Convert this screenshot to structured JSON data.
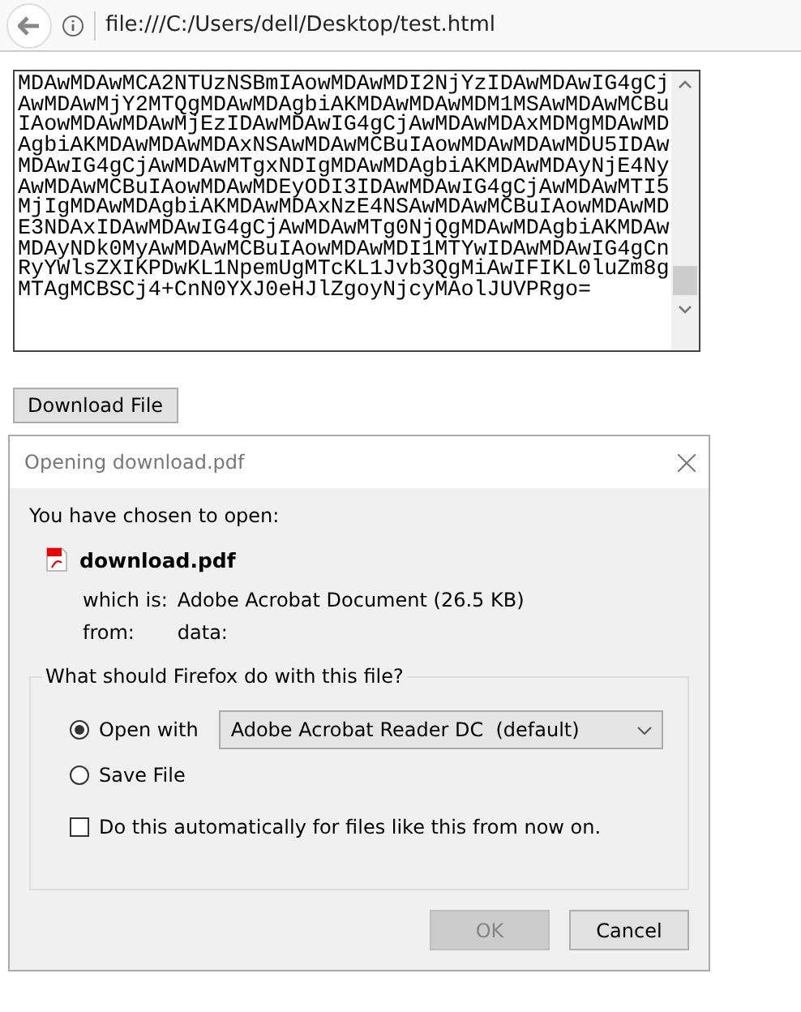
{
  "toolbar": {
    "url": "file:///C:/Users/dell/Desktop/test.html"
  },
  "textarea": {
    "lines": [
      "MDAwMDAwMCA2NTUzNSBmIAowMDAwMDI2NjYzIDAwMDAwIG4gCj",
      "AwMDAwMjY2MTQgMDAwMDAgbiAKMDAwMDAwMDM1MSAwMDAwMCBu",
      "IAowMDAwMDAwMjEzIDAwMDAwIG4gCjAwMDAwMDAxMDMgMDAwMD",
      "AgbiAKMDAwMDAwMDAxNSAwMDAwMCBuIAowMDAwMDAwMDU5IDAw",
      "MDAwIG4gCjAwMDAwMTgxNDIgMDAwMDAgbiAKMDAwMDAyNjE4Ny",
      "AwMDAwMCBuIAowMDAwMDEyODI3IDAwMDAwIG4gCjAwMDAwMTI5",
      "MjIgMDAwMDAgbiAKMDAwMDAxNzE4NSAwMDAwMCBuIAowMDAwMD",
      "E3NDAxIDAwMDAwIG4gCjAwMDAwMTg0NjQgMDAwMDAgbiAKMDAw",
      "MDAyNDk0MyAwMDAwMCBuIAowMDAwMDI1MTYwIDAwMDAwIG4gCn",
      "RyYWlsZXIKPDwKL1NpemUgMTcKL1Jvb3QgMiAwIFIKL0luZm8g",
      "MTAgMCBSCj4+CnN0YXJ0eHJlZgoyNjcyMAolJUVPRgo="
    ]
  },
  "download_button": "Download File",
  "dialog": {
    "title": "Opening download.pdf",
    "intro": "You have chosen to open:",
    "file_name": "download.pdf",
    "which_label": "which is:",
    "which_value": "Adobe Acrobat Document (26.5 KB)",
    "from_label": "from:",
    "from_value": "data:",
    "group_title": "What should Firefox do with this file?",
    "options": [
      {
        "label": "Open with",
        "selected": true,
        "app": "Adobe Acrobat Reader DC  (default)"
      },
      {
        "label": "Save File",
        "selected": false
      }
    ],
    "auto": {
      "label": "Do this automatically for files like this from now on.",
      "checked": false
    },
    "buttons": [
      {
        "label": "OK",
        "disabled": true
      },
      {
        "label": "Cancel",
        "disabled": false
      }
    ]
  }
}
